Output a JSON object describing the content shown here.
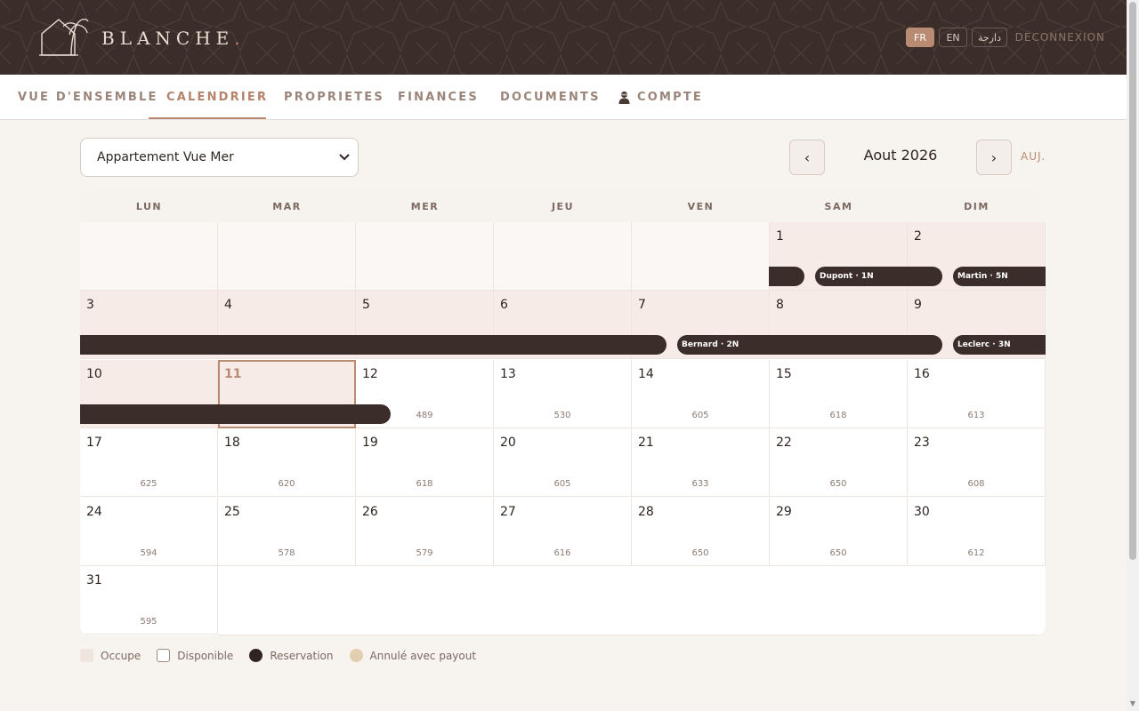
{
  "brand": {
    "name": "BLANCHE",
    "dot": "."
  },
  "languages": [
    {
      "label": "FR",
      "active": true
    },
    {
      "label": "EN",
      "active": false
    },
    {
      "label": "دارجة",
      "active": false
    }
  ],
  "logout_label": "DECONNEXION",
  "nav": {
    "items": [
      "VUE D'ENSEMBLE",
      "CALENDRIER",
      "PROPRIETES",
      "FINANCES",
      "DOCUMENTS",
      "COMPTE"
    ],
    "active": "CALENDRIER"
  },
  "property_select": {
    "value": "Appartement Vue Mer"
  },
  "month": {
    "label": "Aout 2026",
    "prev": "‹",
    "next": "›",
    "today_label": "AUJ."
  },
  "calendar": {
    "weekdays": [
      "LUN",
      "MAR",
      "MER",
      "JEU",
      "VEN",
      "SAM",
      "DIM"
    ],
    "today": 11,
    "occupied_days": [
      1,
      2,
      3,
      4,
      5,
      6,
      7,
      8,
      9,
      10,
      11
    ],
    "prices": {
      "12": "489",
      "13": "530",
      "14": "605",
      "15": "618",
      "16": "613",
      "17": "625",
      "18": "620",
      "19": "618",
      "20": "605",
      "21": "633",
      "22": "650",
      "23": "608",
      "24": "594",
      "25": "578",
      "26": "579",
      "27": "616",
      "28": "650",
      "29": "650",
      "30": "612",
      "31": "595"
    },
    "reservations": [
      {
        "label": ""
      },
      {
        "label": "Dupont · 1N"
      },
      {
        "label": "Martin · 5N"
      },
      {
        "label": ""
      },
      {
        "label": "Bernard · 2N"
      },
      {
        "label": "Leclerc · 3N"
      },
      {
        "label": ""
      }
    ]
  },
  "legend": [
    {
      "label": "Occupe",
      "swatch": "occ"
    },
    {
      "label": "Disponible",
      "swatch": "avail"
    },
    {
      "label": "Reservation",
      "swatch": "res"
    },
    {
      "label": "Annulé avec payout",
      "swatch": "cancel"
    }
  ],
  "colors": {
    "header_bg": "#3b2e2a",
    "accent": "#b98b72",
    "reservation_bar": "#3b2d29",
    "occupied_bg": "#f6ebe6"
  }
}
